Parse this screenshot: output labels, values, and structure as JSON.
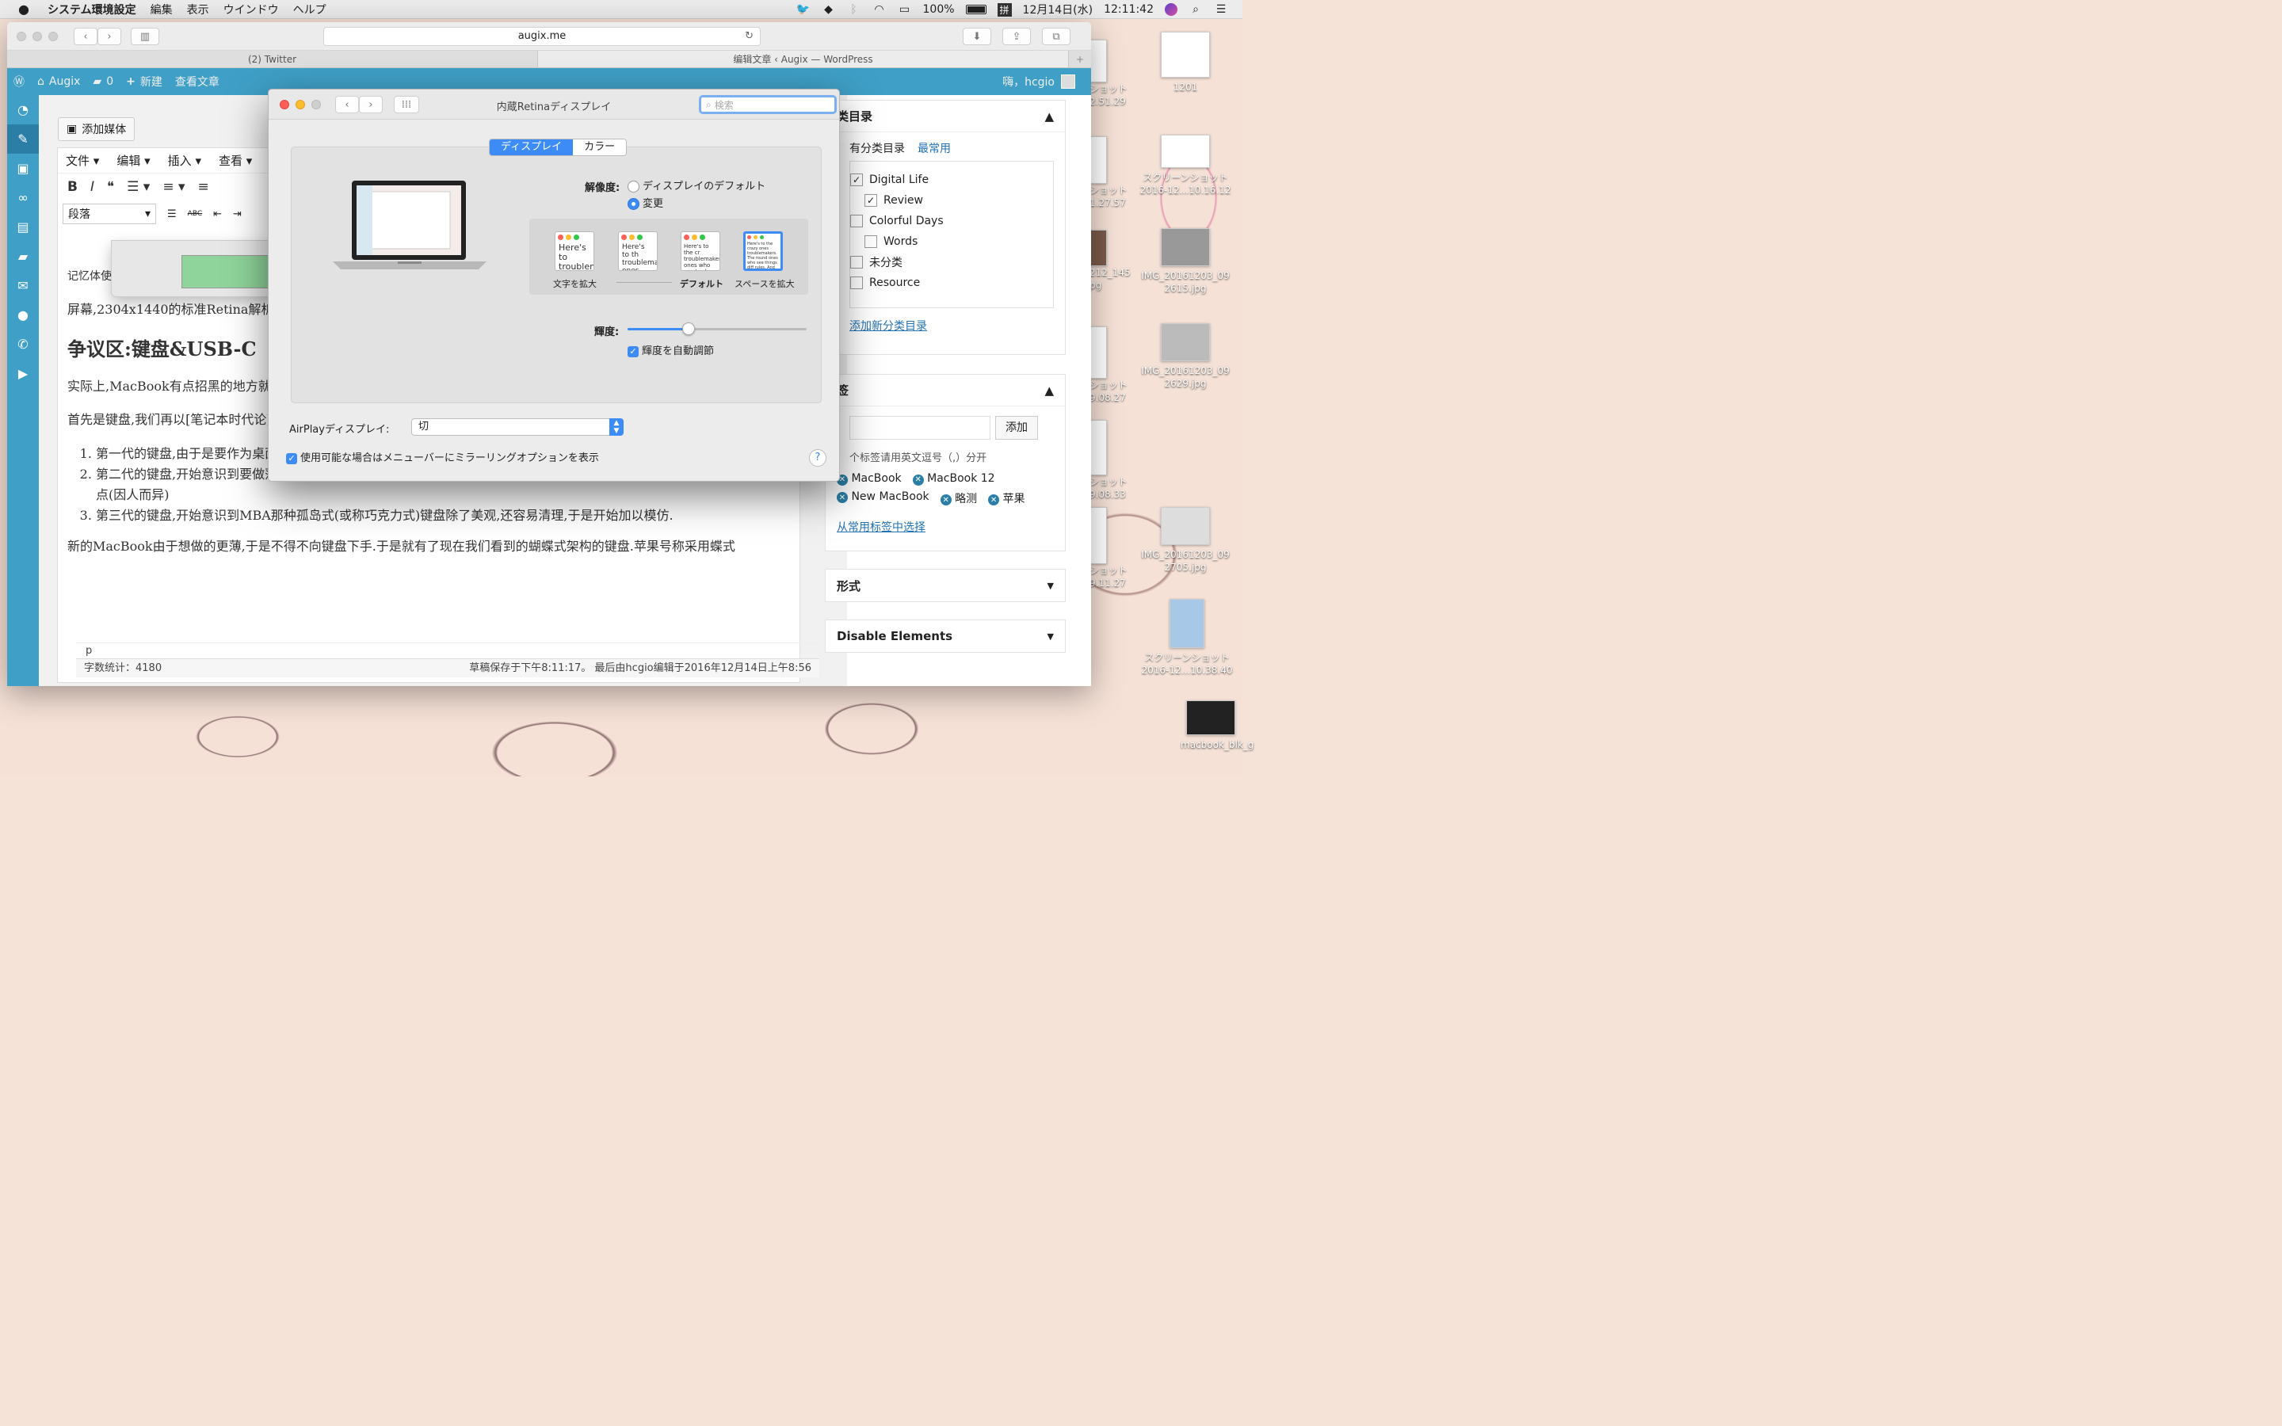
{
  "menubar": {
    "app": "システム環境設定",
    "items": [
      "編集",
      "表示",
      "ウインドウ",
      "ヘルプ"
    ],
    "battery": "100%",
    "input_method": "拼",
    "date": "12月14日(水)",
    "time": "12:11:42"
  },
  "safari": {
    "url": "augix.me",
    "tabs": [
      "(2) Twitter",
      "编辑文章 ‹ Augix — WordPress"
    ]
  },
  "wp_adminbar": {
    "site": "Augix",
    "comments": "0",
    "new": "新建",
    "view": "查看文章",
    "greeting": "嗨，hcgio"
  },
  "editor": {
    "add_media": "添加媒体",
    "menus": [
      "文件",
      "编辑",
      "插入",
      "查看"
    ],
    "format": "段落",
    "content": {
      "p1": "记忆体使用状况",
      "p2": "屏幕,2304x1440的标准Retina解析",
      "h2": "争议区:键盘&USB-C",
      "p3": "实际上,MacBook有点招黑的地方就",
      "p4": "首先是键盘,我们再以[笔记本时代论]看键盘:",
      "list": [
        "第一代的键盘,由于是要作为桌面代替品,所以尽可能把桌面的键盘架构完整移植",
        "第二代的键盘,开始意识到要做薄一点,所以在能保留完整键盘的同时把键程做的短一些,于是手感相对比桌面电脑会差了那么一点(因人而异)",
        "第三代的键盘,开始意识到MBA那种孤岛式(或称巧克力式)键盘除了美观,还容易清理,于是开始加以模仿."
      ],
      "p5": "新的MacBook由于想做的更薄,于是不得不向键盘下手.于是就有了现在我们看到的蝴蝶式架构的键盘.苹果号称采用蝶式"
    },
    "path": "p",
    "wordcount": "字数统计：4180",
    "status": "草稿保存于下午8:11:17。 最后由hcgio编辑于2016年12月14日上午8:56"
  },
  "categories": {
    "title": "类目录",
    "tab_all": "有分类目录",
    "tab_common": "最常用",
    "items": [
      {
        "label": "Digital Life",
        "checked": true
      },
      {
        "label": "Review",
        "checked": true
      },
      {
        "label": "Colorful Days",
        "checked": false
      },
      {
        "label": "Words",
        "checked": false
      },
      {
        "label": "未分类",
        "checked": false
      },
      {
        "label": "Resource",
        "checked": false
      }
    ],
    "add_new": "添加新分类目录"
  },
  "tags": {
    "title": "签",
    "add_button": "添加",
    "hint": "个标签请用英文逗号（,）分开",
    "items": [
      "MacBook",
      "MacBook 12",
      "New MacBook",
      "略测",
      "苹果"
    ],
    "choose": "从常用标签中选择"
  },
  "format_panel": {
    "title": "形式"
  },
  "disable_panel": {
    "title": "Disable Elements"
  },
  "prefs": {
    "title": "内蔵Retinaディスプレイ",
    "search_placeholder": "検索",
    "seg_display": "ディスプレイ",
    "seg_color": "カラー",
    "resolution_label": "解像度:",
    "res_default": "ディスプレイのデフォルト",
    "res_scaled": "変更",
    "scales": [
      {
        "label": "文字を拡大",
        "text": "Here's to troublem"
      },
      {
        "label": "",
        "text": "Here's to th troublemak ones who"
      },
      {
        "label": "デフォルト",
        "text": "Here's to the cr troublemakers. ones who see t rules. And they"
      },
      {
        "label": "スペースを拡大",
        "text": "Here's to the crazy ones troublemakers. The round ones who see things diff rules. And they have no can quote them, disagree them. About the only thin Because they change thi"
      }
    ],
    "brightness_label": "輝度:",
    "brightness": 0.34,
    "auto_brightness": "輝度を自動調節",
    "airplay_label": "AirPlayディスプレイ:",
    "airplay_value": "切",
    "mirror_option": "使用可能な場合はメニューバーにミラーリングオプションを表示",
    "help": "?"
  },
  "desktop": {
    "icons": [
      {
        "label": "1201"
      },
      {
        "label": "ショット 2.51.29"
      },
      {
        "label": "スクリーンショット 2016-12...10.16.12"
      },
      {
        "label": "ショット 1.27.57"
      },
      {
        "label": "IMG_20161203_09 2615.jpg"
      },
      {
        "label": "212_145 pg"
      },
      {
        "label": "IMG_20161203_09 2629.jpg"
      },
      {
        "label": "ショット 9.08.27"
      },
      {
        "label": "ショット 9.08.33"
      },
      {
        "label": "IMG_20161203_09 2705.jpg"
      },
      {
        "label": "ショット 9.11.27"
      },
      {
        "label": "スクリーンショット 2016-12...10.38.40"
      },
      {
        "label": "macbook_blk_g"
      }
    ]
  }
}
